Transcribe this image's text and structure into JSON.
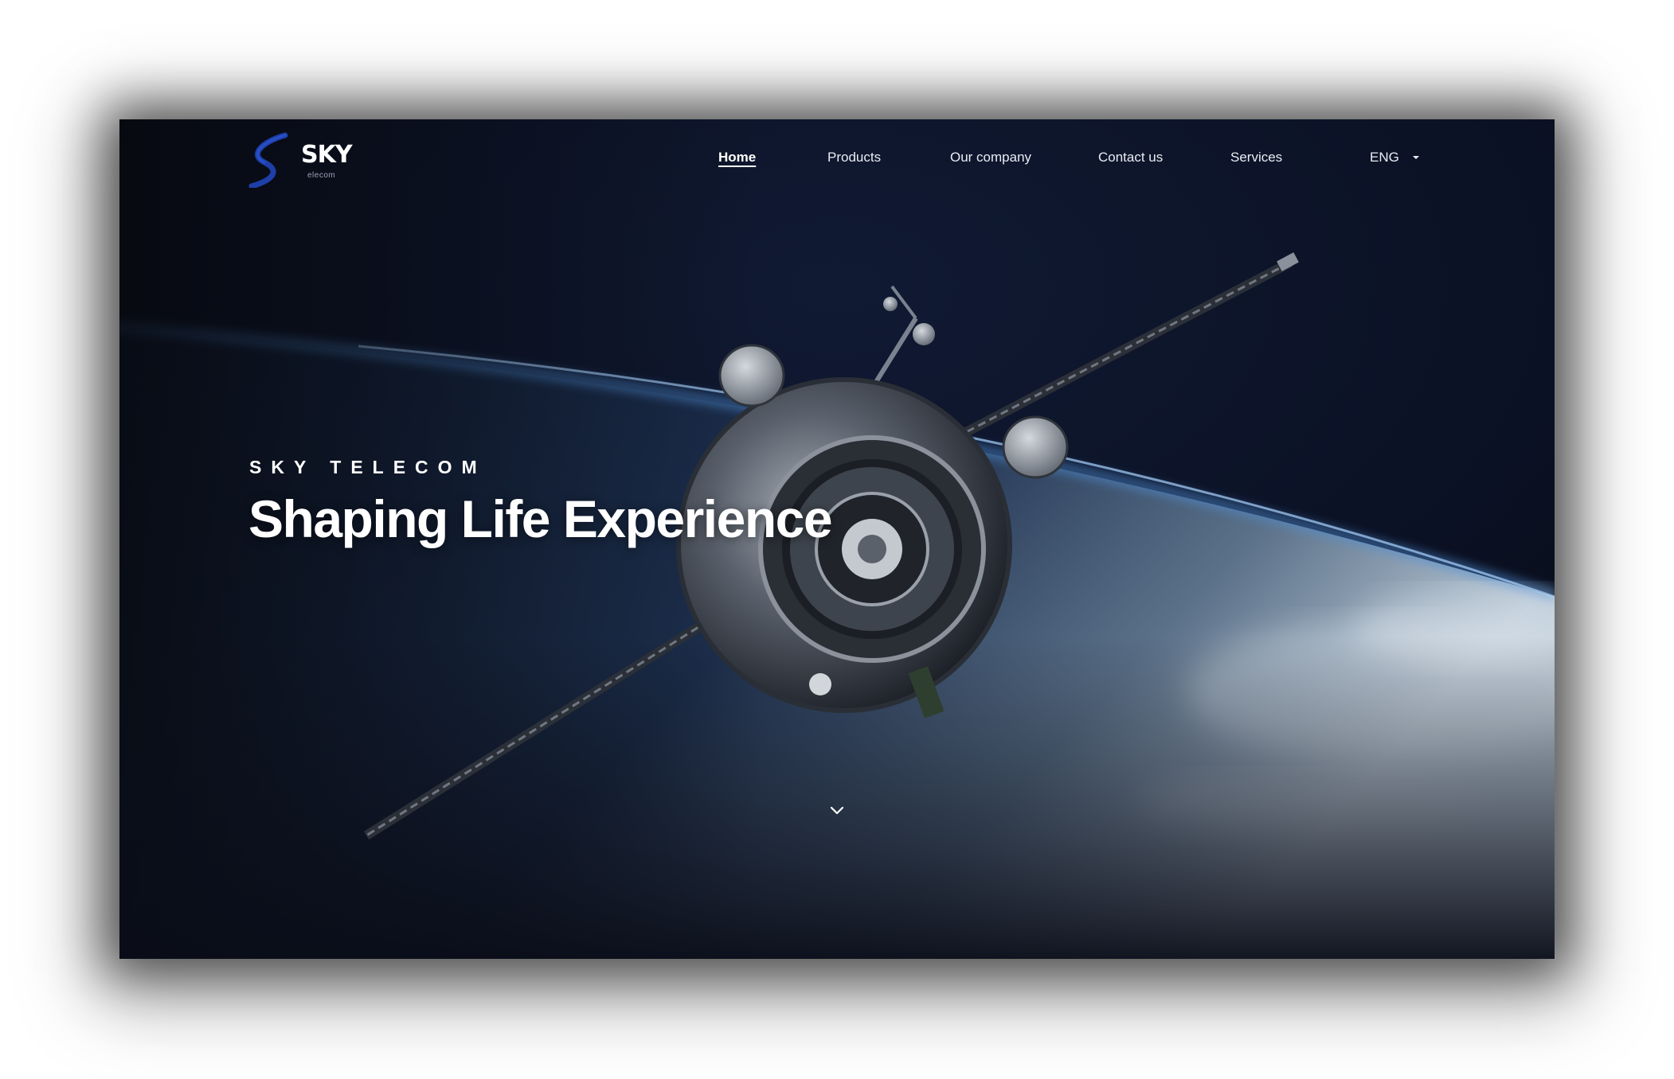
{
  "brand": {
    "name": "SKY",
    "sub": "elecom",
    "accent_color": "#1e3fa8"
  },
  "nav": {
    "items": [
      {
        "label": "Home",
        "active": true
      },
      {
        "label": "Products",
        "active": false
      },
      {
        "label": "Our company",
        "active": false
      },
      {
        "label": "Contact us",
        "active": false
      },
      {
        "label": "Services",
        "active": false
      }
    ],
    "language": {
      "selected": "ENG",
      "icon": "caret-down-icon"
    }
  },
  "hero": {
    "eyebrow": "SKY TELECOM",
    "headline": "Shaping Life Experience",
    "scroll_icon": "chevron-down-icon",
    "image": "satellite-over-earth"
  },
  "colors": {
    "background": "#0a0d18",
    "text": "#ffffff",
    "earth_glow": "#4f8fd6"
  }
}
